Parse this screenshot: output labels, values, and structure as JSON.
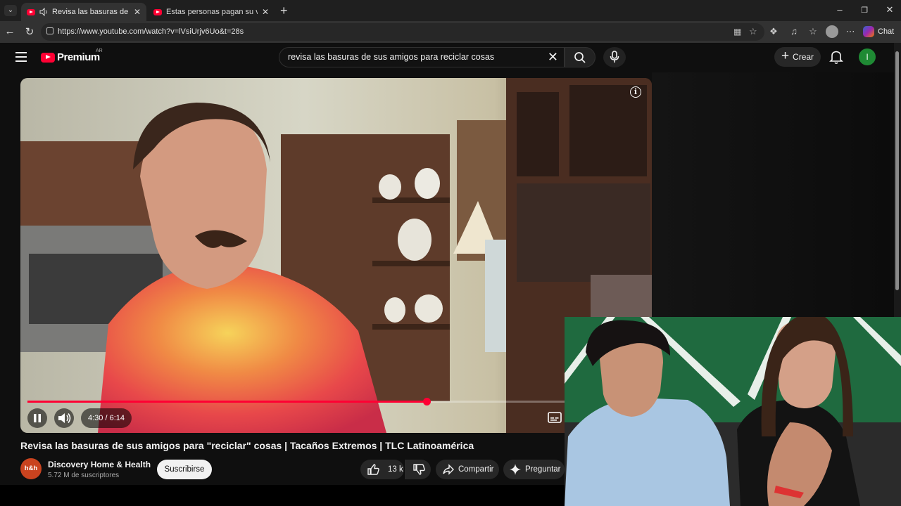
{
  "browser": {
    "tabs": [
      {
        "title": "Revisa las basuras de sus amigos",
        "active": true
      },
      {
        "title": "Estas personas pagan su vida con",
        "active": false
      }
    ],
    "url": "https://www.youtube.com/watch?v=lVsiUrjv6Uo&t=28s",
    "chat_label": "Chat"
  },
  "youtube": {
    "logo_text": "Premium",
    "region": "AR",
    "search_query": "revisa las basuras de sus amigos para reciclar cosas",
    "create_label": "Crear",
    "avatar_letter": "I"
  },
  "player": {
    "time_display": "4:30 / 6:14",
    "progress": 0.733
  },
  "video": {
    "title": "Revisa las basuras de sus amigos para \"reciclar\" cosas | Tacaños Extremos | TLC Latinoamérica",
    "channel_name": "Discovery Home & Health",
    "channel_avatar_text": "h&h",
    "subscribers": "5.72 M de suscriptores",
    "subscribe_label": "Suscribirse",
    "likes": "13 k",
    "share_label": "Compartir",
    "ask_label": "Preguntar"
  },
  "colors": {
    "accent": "#ff0033",
    "background": "#0f0f0f",
    "avatar": "#1f8a34"
  }
}
